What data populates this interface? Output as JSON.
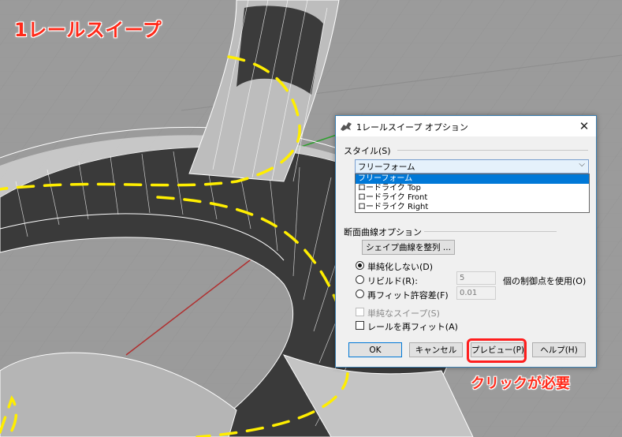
{
  "annotations": {
    "title": "1レールスイープ",
    "note": "クリックが必要"
  },
  "dialog": {
    "title": "1レールスイープ オプション",
    "style_label": "スタイル(S)",
    "style_selected": "フリーフォーム",
    "style_options": [
      "フリーフォーム",
      "ロードライク Top",
      "ロードライク Front",
      "ロードライク Right"
    ],
    "section_label": "断面曲線オプション",
    "align_button": "シェイプ曲線を整列 ...",
    "radio_no_simplify": "単純化しない(D)",
    "radio_rebuild": "リビルド(R):",
    "rebuild_value": "5",
    "rebuild_suffix": "個の制御点を使用(O)",
    "radio_refit": "再フィット許容差(F)",
    "refit_value": "0.01",
    "check_simple_sweep": "単純なスイープ(S)",
    "check_refit_rail": "レールを再フィット(A)",
    "btn_ok": "OK",
    "btn_cancel": "キャンセル",
    "btn_preview": "プレビュー(P)",
    "btn_help": "ヘルプ(H)"
  },
  "colors": {
    "accent_red": "#ff2a1a",
    "rail_yellow": "#ffee00",
    "selection_blue": "#0078d7"
  }
}
